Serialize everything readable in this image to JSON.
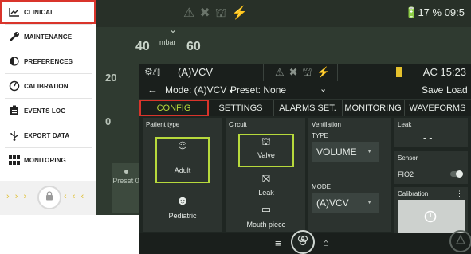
{
  "menu": {
    "items": [
      {
        "label": "CLINICAL",
        "icon": "chart-line-icon"
      },
      {
        "label": "MAINTENANCE",
        "icon": "wrench-icon"
      },
      {
        "label": "PREFERENCES",
        "icon": "preferences-icon"
      },
      {
        "label": "CALIBRATION",
        "icon": "calibration-icon"
      },
      {
        "label": "EVENTS LOG",
        "icon": "clipboard-icon"
      },
      {
        "label": "EXPORT DATA",
        "icon": "usb-icon"
      },
      {
        "label": "MONITORING",
        "icon": "grid-icon"
      }
    ],
    "arrows_left": "› › ›",
    "arrows_right": "‹ ‹ ‹"
  },
  "background": {
    "status": "🔋17 % 09:5",
    "gauge_left": "40",
    "gauge_unit": "mbar",
    "gauge_right": "60",
    "side_value_1": "20",
    "side_value_2": "0",
    "preset_label": "Preset 0"
  },
  "device": {
    "mode_title": "(A)VCV",
    "battery_text": "AC 15:23",
    "mode_select": "Mode: (A)VCV",
    "preset_select": "Preset: None",
    "save": "Save",
    "load": "Load",
    "tabs": [
      "CONFIG",
      "SETTINGS",
      "ALARMS SET.",
      "MONITORING",
      "WAVEFORMS"
    ],
    "patient_type": {
      "title": "Patient type",
      "options": [
        "Adult",
        "Pediatric"
      ],
      "selected": "Adult"
    },
    "circuit": {
      "title": "Circuit",
      "options": [
        "Valve",
        "Leak",
        "Mouth piece"
      ],
      "selected": "Valve"
    },
    "ventilation": {
      "title": "Ventilation",
      "type_label": "TYPE",
      "type_value": "VOLUME",
      "mode_label": "MODE",
      "mode_value": "(A)VCV"
    },
    "leak": {
      "title": "Leak",
      "value": "- -"
    },
    "sensor": {
      "title": "Sensor",
      "label": "FIO2",
      "enabled": false
    },
    "calibration": {
      "title": "Calibration",
      "menu": "⋮"
    }
  },
  "colors": {
    "accent_green": "#b7d93c",
    "highlight_red": "#d9342b",
    "battery_yellow": "#e5c12d"
  }
}
